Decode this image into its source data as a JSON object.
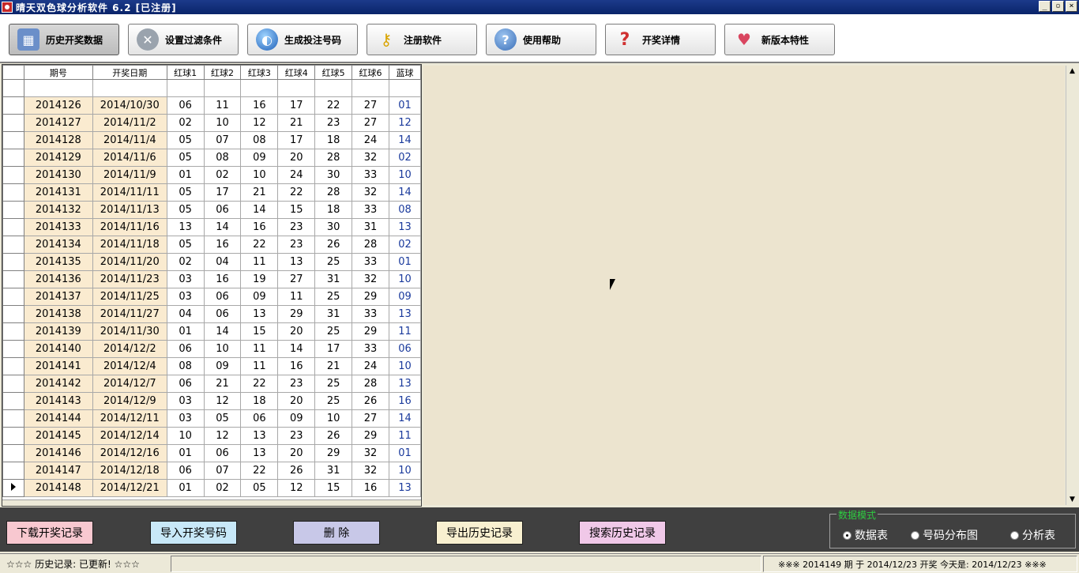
{
  "window": {
    "title": "晴天双色球分析软件 6.2  [已注册]",
    "controls": [
      "_",
      "▫",
      "×"
    ]
  },
  "toolbar": [
    {
      "label": "历史开奖数据",
      "icon": "history-chart-icon",
      "active": true
    },
    {
      "label": "设置过滤条件",
      "icon": "tools-icon"
    },
    {
      "label": "生成投注号码",
      "icon": "globe-icon"
    },
    {
      "label": "注册软件",
      "icon": "key-icon"
    },
    {
      "label": "使用帮助",
      "icon": "help-icon"
    },
    {
      "label": "开奖详情",
      "icon": "question-icon"
    },
    {
      "label": "新版本特性",
      "icon": "heart-icon"
    }
  ],
  "grid": {
    "columns": [
      "期号",
      "开奖日期",
      "红球1",
      "红球2",
      "红球3",
      "红球4",
      "红球5",
      "红球6",
      "蓝球"
    ],
    "rows": [
      [
        "2014126",
        "2014/10/30",
        "06",
        "11",
        "16",
        "17",
        "22",
        "27",
        "01"
      ],
      [
        "2014127",
        "2014/11/2",
        "02",
        "10",
        "12",
        "21",
        "23",
        "27",
        "12"
      ],
      [
        "2014128",
        "2014/11/4",
        "05",
        "07",
        "08",
        "17",
        "18",
        "24",
        "14"
      ],
      [
        "2014129",
        "2014/11/6",
        "05",
        "08",
        "09",
        "20",
        "28",
        "32",
        "02"
      ],
      [
        "2014130",
        "2014/11/9",
        "01",
        "02",
        "10",
        "24",
        "30",
        "33",
        "10"
      ],
      [
        "2014131",
        "2014/11/11",
        "05",
        "17",
        "21",
        "22",
        "28",
        "32",
        "14"
      ],
      [
        "2014132",
        "2014/11/13",
        "05",
        "06",
        "14",
        "15",
        "18",
        "33",
        "08"
      ],
      [
        "2014133",
        "2014/11/16",
        "13",
        "14",
        "16",
        "23",
        "30",
        "31",
        "13"
      ],
      [
        "2014134",
        "2014/11/18",
        "05",
        "16",
        "22",
        "23",
        "26",
        "28",
        "02"
      ],
      [
        "2014135",
        "2014/11/20",
        "02",
        "04",
        "11",
        "13",
        "25",
        "33",
        "01"
      ],
      [
        "2014136",
        "2014/11/23",
        "03",
        "16",
        "19",
        "27",
        "31",
        "32",
        "10"
      ],
      [
        "2014137",
        "2014/11/25",
        "03",
        "06",
        "09",
        "11",
        "25",
        "29",
        "09"
      ],
      [
        "2014138",
        "2014/11/27",
        "04",
        "06",
        "13",
        "29",
        "31",
        "33",
        "13"
      ],
      [
        "2014139",
        "2014/11/30",
        "01",
        "14",
        "15",
        "20",
        "25",
        "29",
        "11"
      ],
      [
        "2014140",
        "2014/12/2",
        "06",
        "10",
        "11",
        "14",
        "17",
        "33",
        "06"
      ],
      [
        "2014141",
        "2014/12/4",
        "08",
        "09",
        "11",
        "16",
        "21",
        "24",
        "10"
      ],
      [
        "2014142",
        "2014/12/7",
        "06",
        "21",
        "22",
        "23",
        "25",
        "28",
        "13"
      ],
      [
        "2014143",
        "2014/12/9",
        "03",
        "12",
        "18",
        "20",
        "25",
        "26",
        "16"
      ],
      [
        "2014144",
        "2014/12/11",
        "03",
        "05",
        "06",
        "09",
        "10",
        "27",
        "14"
      ],
      [
        "2014145",
        "2014/12/14",
        "10",
        "12",
        "13",
        "23",
        "26",
        "29",
        "11"
      ],
      [
        "2014146",
        "2014/12/16",
        "01",
        "06",
        "13",
        "20",
        "29",
        "32",
        "01"
      ],
      [
        "2014147",
        "2014/12/18",
        "06",
        "07",
        "22",
        "26",
        "31",
        "32",
        "10"
      ],
      [
        "2014148",
        "2014/12/21",
        "01",
        "02",
        "05",
        "12",
        "15",
        "16",
        "13"
      ]
    ],
    "current_row": 22
  },
  "bottom": {
    "buttons": [
      {
        "label": "下载开奖记录",
        "color": "#F8C8D0"
      },
      {
        "label": "导入开奖号码",
        "color": "#C8E8F8"
      },
      {
        "label": "删  除",
        "color": "#C8C8E8"
      },
      {
        "label": "导出历史记录",
        "color": "#F8F0D0"
      },
      {
        "label": "搜索历史记录",
        "color": "#F0C8E8"
      }
    ],
    "mode_title": "数据模式",
    "modes": [
      {
        "label": "数据表",
        "selected": true
      },
      {
        "label": "号码分布图",
        "selected": false
      },
      {
        "label": "分析表",
        "selected": false
      }
    ]
  },
  "status": {
    "left": "☆☆☆  历史记录: 已更新!  ☆☆☆",
    "right": "※※※  2014149 期 于 2014/12/23 开奖      今天是: 2014/12/23 ※※※"
  }
}
